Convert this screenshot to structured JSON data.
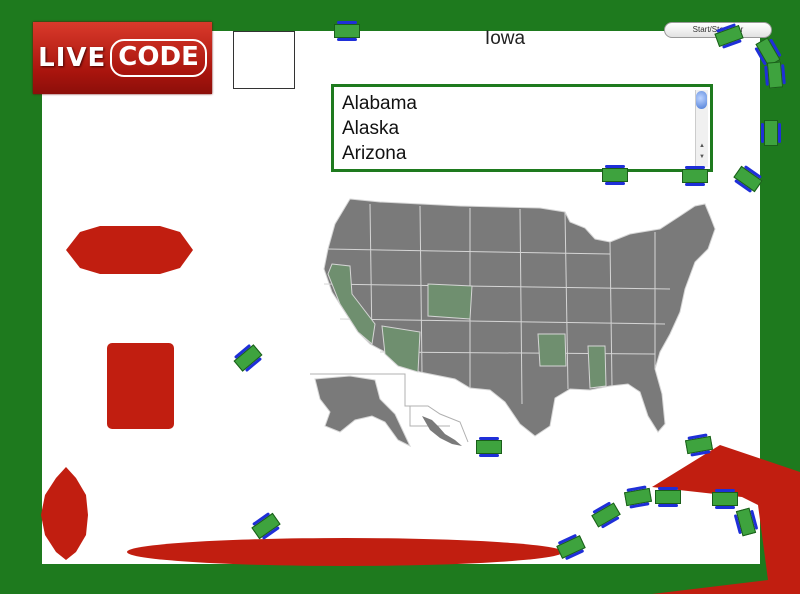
{
  "logo": {
    "text_live": "LIVE",
    "text_code": "CODE"
  },
  "current_state": "Iowa",
  "start_button": {
    "label": "Start/Stop Car"
  },
  "state_list": {
    "items": [
      "Alabama",
      "Alaska",
      "Arizona"
    ]
  },
  "colors": {
    "frame": "#1e7a1e",
    "shapes": "#c11e10",
    "map": "#7a7a7a",
    "highlight": "#6f8f6f",
    "car": "#3ea33e",
    "car_wheels": "#1f2fd8"
  }
}
